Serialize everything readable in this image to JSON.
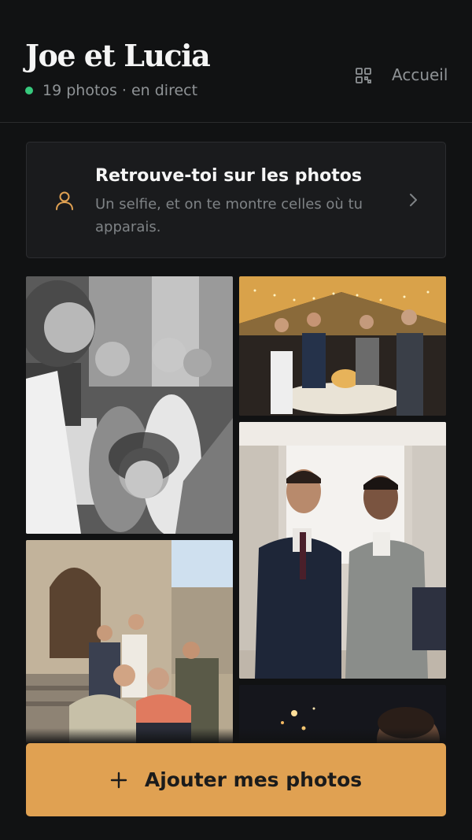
{
  "header": {
    "title": "Joe et Lucia",
    "photo_count": "19 photos",
    "separator": "·",
    "live_label": "en direct",
    "home_label": "Accueil",
    "qr_icon": "qr-code-icon",
    "live_color": "#37c97d"
  },
  "find_card": {
    "title": "Retrouve-toi sur les photos",
    "subtitle": "Un selfie, et on te montre celles où tu apparais.",
    "icon": "person-icon",
    "chevron_icon": "chevron-right-icon"
  },
  "gallery": {
    "photos": [
      {
        "subject": "bridal party in hotel room, black and white"
      },
      {
        "subject": "guests toasting at dinner table under string lights"
      },
      {
        "subject": "two men in suits smiling"
      },
      {
        "subject": "guests group selfie in front of stone church"
      },
      {
        "subject": "night scene with sparklers"
      }
    ]
  },
  "add_button": {
    "label": "Ajouter mes photos",
    "icon": "plus-icon",
    "color": "#e0a152"
  }
}
